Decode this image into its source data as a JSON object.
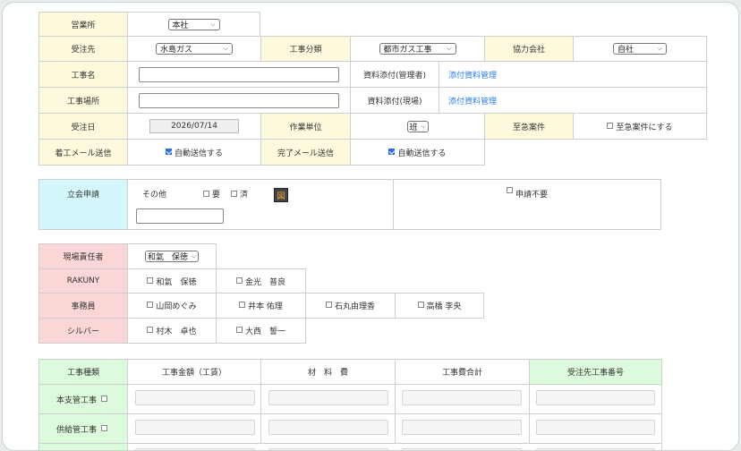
{
  "row1": {
    "office_label": "営業所",
    "office_value": "本社"
  },
  "row2": {
    "client_label": "受注先",
    "client_value": "水島ガス",
    "category_label": "工事分類",
    "category_value": "都市ガス工事",
    "partner_label": "協力会社",
    "partner_value": "自社"
  },
  "row3": {
    "name_label": "工事名",
    "name_value": "",
    "attach_mgr_label": "資料添付(管理者)",
    "attach_mgr_link": "添付資料管理"
  },
  "row4": {
    "site_label": "工事場所",
    "site_value": "",
    "attach_site_label": "資料添付(現場)",
    "attach_site_link": "添付資料管理"
  },
  "row5": {
    "order_date_label": "受注日",
    "order_date_value": "2026/07/14",
    "unit_label": "作業単位",
    "unit_value": "班",
    "urgent_label": "至急案件",
    "urgent_check_label": "至急案件にする",
    "urgent_checked": false
  },
  "row6": {
    "start_mail_label": "着工メール送信",
    "start_mail_check": "自動送信する",
    "start_mail_checked": true,
    "done_mail_label": "完了メール送信",
    "done_mail_check": "自動送信する",
    "done_mail_checked": true
  },
  "witness": {
    "label": "立会申請",
    "other_label": "その他",
    "need_label": "要",
    "done_label": "済",
    "map_icon_glyph": "図",
    "other_value": "",
    "no_apply_label": "申請不要"
  },
  "staff": {
    "manager_label": "現場責任者",
    "manager_value": "和氣　保徳",
    "rakuny_label": "RAKUNY",
    "rakuny": [
      "和氣　保徳",
      "金光　普良"
    ],
    "office_label": "事務員",
    "office": [
      "山岡めぐみ",
      "井本 佑理",
      "石丸由理香",
      "高橋 李央"
    ],
    "silver_label": "シルバー",
    "silver": [
      "村木　卓也",
      "大西　誓一"
    ]
  },
  "cost": {
    "headers": [
      "工事種類",
      "工事金額（工賃）",
      "材　料　費",
      "工事費合計",
      "受注先工事番号"
    ],
    "rows": [
      {
        "label": "本支管工事"
      },
      {
        "label": "供給管工事"
      }
    ]
  },
  "colors": {
    "yellow": "#fdf9dc",
    "cyan": "#d4f7fb",
    "pink": "#fbd6d6",
    "green": "#dcfadc",
    "link": "#2b7de9"
  }
}
